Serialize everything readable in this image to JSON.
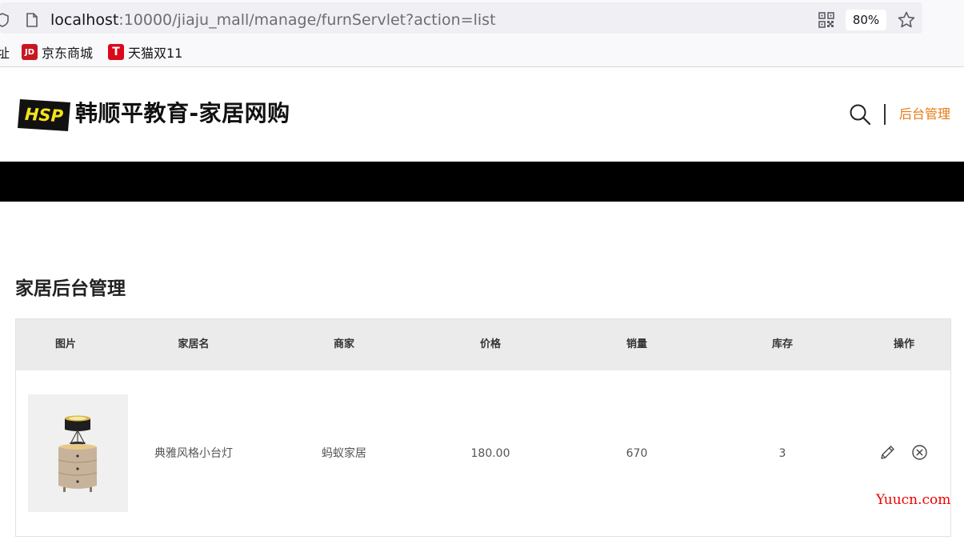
{
  "browser": {
    "url_host": "localhost",
    "url_rest": ":10000/jiaju_mall/manage/furnServlet?action=list",
    "zoom": "80%",
    "bookmarks": [
      {
        "label": "址",
        "icon": "truncated-bookmark"
      },
      {
        "label": "京东商城",
        "icon": "jd-logo-icon",
        "icon_text": "JD"
      },
      {
        "label": "天猫双11",
        "icon": "tmall-logo-icon",
        "icon_text": "T"
      }
    ]
  },
  "header": {
    "logo_text": "HSP",
    "site_title": "韩顺平教育-家居网购",
    "admin_link": "后台管理"
  },
  "main": {
    "page_title": "家居后台管理",
    "table": {
      "columns": [
        "图片",
        "家居名",
        "商家",
        "价格",
        "销量",
        "库存",
        "操作"
      ],
      "rows": [
        {
          "image": "lamp-nightstand-image",
          "name": "典雅风格小台灯",
          "merchant": "蚂蚁家居",
          "price": "180.00",
          "sales": "670",
          "stock": "3"
        }
      ]
    }
  },
  "watermark": "Yuucn.com",
  "colors": {
    "accent": "#e47911",
    "logo_bg": "#111111",
    "logo_text": "#f3e31a",
    "band": "#000000",
    "table_header_bg": "#ebebeb"
  }
}
